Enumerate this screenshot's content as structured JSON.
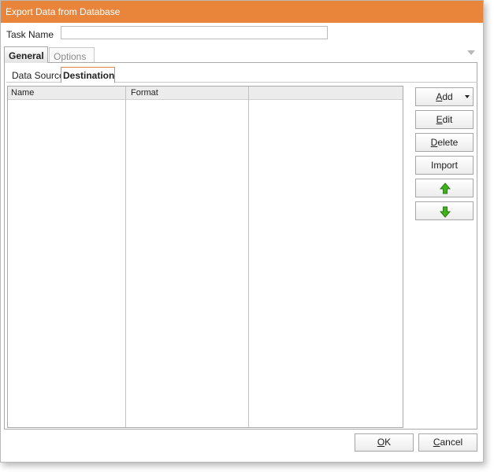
{
  "window": {
    "title": "Export Data from Database"
  },
  "task": {
    "label": "Task Name",
    "value": ""
  },
  "tabs": [
    {
      "label": "General"
    },
    {
      "label": "Options"
    }
  ],
  "subtabs": [
    {
      "label": "Data Source"
    },
    {
      "label": "Destination"
    }
  ],
  "grid": {
    "columns": [
      {
        "label": "Name"
      },
      {
        "label": "Format"
      },
      {
        "label": ""
      }
    ],
    "rows": []
  },
  "buttons": {
    "add": {
      "pre": "",
      "key": "A",
      "post": "dd"
    },
    "edit": {
      "pre": "",
      "key": "E",
      "post": "dit"
    },
    "delete": {
      "pre": "",
      "key": "D",
      "post": "elete"
    },
    "import": {
      "label": "Import"
    },
    "move_up_icon": "arrow-up-icon",
    "move_down_icon": "arrow-down-icon"
  },
  "footer": {
    "ok": {
      "key": "O",
      "post": "K"
    },
    "cancel": {
      "key": "C",
      "post": "ancel"
    }
  },
  "colors": {
    "titlebar": "#e8853a",
    "accent": "#e8853a",
    "arrow_green": "#3fb11c"
  }
}
